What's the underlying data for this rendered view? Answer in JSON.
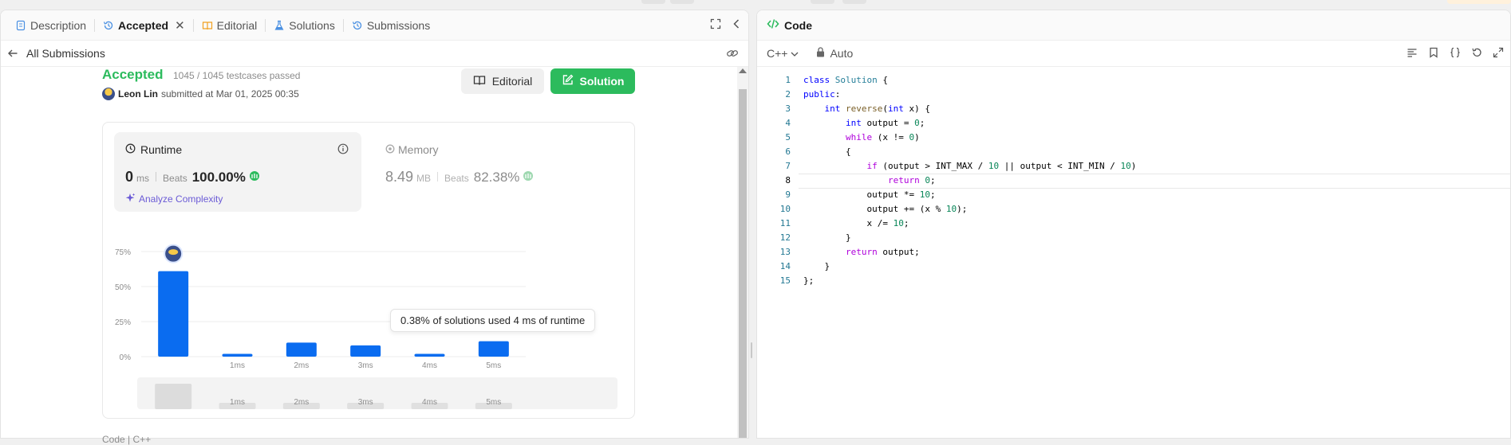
{
  "left_tabs": [
    {
      "label": "Description",
      "icon": "document-icon",
      "active": false
    },
    {
      "label": "Accepted",
      "icon": "history-icon",
      "active": true
    },
    {
      "label": "Editorial",
      "icon": "book-icon",
      "active": false
    },
    {
      "label": "Solutions",
      "icon": "flask-icon",
      "active": false
    },
    {
      "label": "Submissions",
      "icon": "history-icon",
      "active": false
    }
  ],
  "subbar": {
    "back_label": "All Submissions"
  },
  "submission": {
    "status": "Accepted",
    "testcases": "1045 / 1045 testcases passed",
    "user": "Leon Lin",
    "submitted_text": "submitted at Mar 01, 2025 00:35"
  },
  "buttons": {
    "editorial": "Editorial",
    "solution": "Solution"
  },
  "runtime": {
    "title": "Runtime",
    "value": "0",
    "unit": "ms",
    "beats_label": "Beats",
    "beats_value": "100.00%",
    "analyze": "Analyze Complexity"
  },
  "memory": {
    "title": "Memory",
    "value": "8.49",
    "unit": "MB",
    "beats_label": "Beats",
    "beats_value": "82.38%"
  },
  "tooltip": "0.38% of solutions used 4 ms of runtime",
  "footer_cut": "Code | C++",
  "chart_data": {
    "type": "bar",
    "categories": [
      "0ms",
      "1ms",
      "2ms",
      "3ms",
      "4ms",
      "5ms"
    ],
    "tick_labels": [
      "",
      "1ms",
      "2ms",
      "3ms",
      "4ms",
      "5ms"
    ],
    "values": [
      61,
      2,
      10,
      8,
      2,
      11
    ],
    "ylim": [
      0,
      75
    ],
    "yticks": [
      "0%",
      "25%",
      "50%",
      "75%"
    ],
    "ytick_values": [
      0,
      25,
      50,
      75
    ],
    "minimap_labels": [
      "1ms",
      "2ms",
      "3ms",
      "4ms",
      "5ms"
    ],
    "bar_color": "#0a6cf0",
    "grid": true
  },
  "code_panel": {
    "title": "Code",
    "language": "C++",
    "mode": "Auto",
    "lines": [
      "class Solution {",
      "public:",
      "    int reverse(int x) {",
      "        int output = 0;",
      "        while (x != 0)",
      "        {",
      "            if (output > INT_MAX / 10 || output < INT_MIN / 10)",
      "                return 0;",
      "            output *= 10;",
      "            output += (x % 10);",
      "            x /= 10;",
      "        }",
      "        return output;",
      "    }",
      "};"
    ]
  },
  "colors": {
    "accent_green": "#2cbb5d",
    "bar_blue": "#0a6cf0",
    "analyze_purple": "#6b5bd6"
  }
}
